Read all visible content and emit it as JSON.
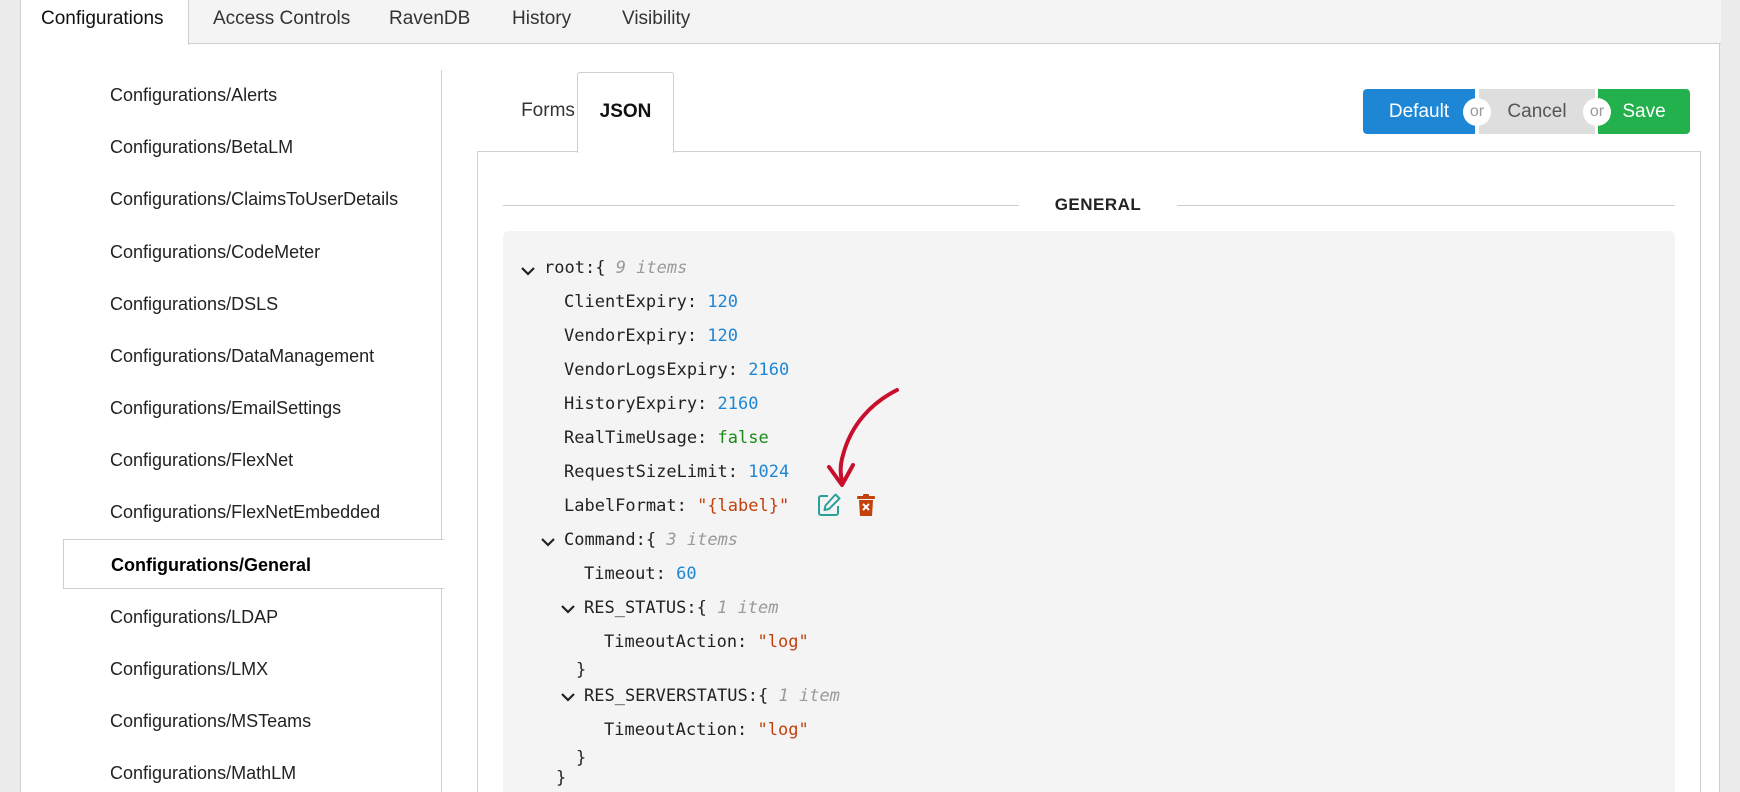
{
  "top_tabs": [
    "Configurations",
    "Access Controls",
    "RavenDB",
    "History",
    "Visibility"
  ],
  "sidebar": {
    "items": [
      "Configurations/Alerts",
      "Configurations/BetaLM",
      "Configurations/ClaimsToUserDetails",
      "Configurations/CodeMeter",
      "Configurations/DSLS",
      "Configurations/DataManagement",
      "Configurations/EmailSettings",
      "Configurations/FlexNet",
      "Configurations/FlexNetEmbedded",
      "Configurations/General",
      "Configurations/LDAP",
      "Configurations/LMX",
      "Configurations/MSTeams",
      "Configurations/MathLM"
    ],
    "active_item": "Configurations/General"
  },
  "subtabs": {
    "forms": "Forms",
    "json": "JSON",
    "active": "JSON"
  },
  "actions": {
    "default": "Default",
    "cancel": "Cancel",
    "save": "Save",
    "or": "or"
  },
  "section": {
    "title": "GENERAL"
  },
  "json": {
    "root": {
      "key": "root:",
      "brace": "{",
      "count": "9 items"
    },
    "props": [
      {
        "key": "ClientExpiry:",
        "value": "120",
        "type": "num"
      },
      {
        "key": "VendorExpiry:",
        "value": "120",
        "type": "num"
      },
      {
        "key": "VendorLogsExpiry:",
        "value": "2160",
        "type": "num"
      },
      {
        "key": "HistoryExpiry:",
        "value": "2160",
        "type": "num"
      },
      {
        "key": "RealTimeUsage:",
        "value": "false",
        "type": "bool"
      },
      {
        "key": "RequestSizeLimit:",
        "value": "1024",
        "type": "num"
      },
      {
        "key": "LabelFormat:",
        "value": "\"{label}\"",
        "type": "str"
      }
    ],
    "command": {
      "key": "Command:",
      "brace": "{",
      "count": "3 items"
    },
    "timeout": {
      "key": "Timeout:",
      "value": "60"
    },
    "res_status": {
      "key": "RES_STATUS:",
      "brace": "{",
      "count": "1 item"
    },
    "res_status_action": {
      "key": "TimeoutAction:",
      "value": "\"log\""
    },
    "res_serverstatus": {
      "key": "RES_SERVERSTATUS:",
      "brace": "{",
      "count": "1 item"
    },
    "res_serverstatus_action": {
      "key": "TimeoutAction:",
      "value": "\"log\""
    },
    "close_brace": "}"
  },
  "icons": {
    "edit": "edit-pencil-icon",
    "delete": "delete-icon",
    "annotation": "red-arrow"
  },
  "colors": {
    "primary": "#1e87d5",
    "save": "#22b14c",
    "number": "#1e87d5",
    "boolean": "#1a8a1a",
    "string": "#c2410c",
    "edit_icon": "#2aa198",
    "delete_icon": "#c2410c",
    "arrow": "#c8102e"
  }
}
